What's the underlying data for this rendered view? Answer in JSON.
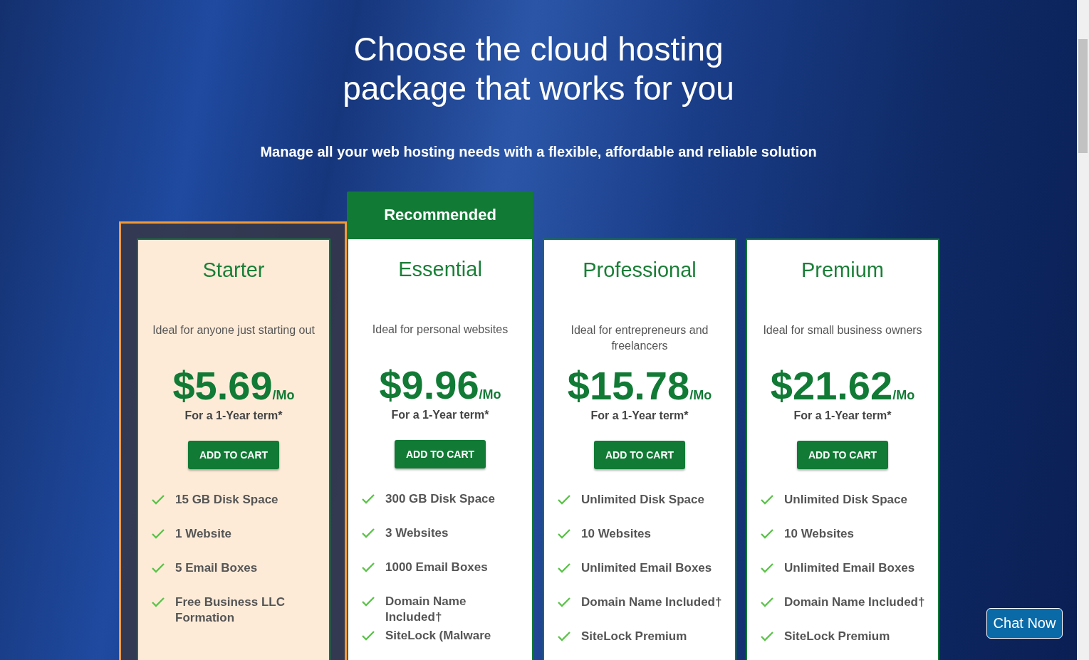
{
  "heading": {
    "title_lines": [
      "Choose the cloud hosting",
      "package that works for you"
    ],
    "subtitle": "Manage all your web hosting needs with a flexible, affordable and reliable solution"
  },
  "plans": [
    {
      "name": "Starter",
      "highlighted": true,
      "description": "Ideal for anyone just starting out",
      "price": "$5.69",
      "per": "/Mo",
      "term": "For a 1-Year term*",
      "button": "ADD TO CART",
      "features": [
        "15 GB Disk Space",
        "1 Website",
        "5 Email Boxes",
        "Free Business LLC Formation"
      ]
    },
    {
      "name": "Essential",
      "highlighted": false,
      "badge": "Recommended",
      "description": "Ideal for personal websites",
      "price": "$9.96",
      "per": "/Mo",
      "term": "For a 1-Year term*",
      "button": "ADD TO CART",
      "features": [
        "300 GB Disk Space",
        "3 Websites",
        "1000 Email Boxes",
        "Domain Name Included†",
        "SiteLock (Malware"
      ]
    },
    {
      "name": "Professional",
      "highlighted": false,
      "description": "Ideal for entrepreneurs and freelancers",
      "price": "$15.78",
      "per": "/Mo",
      "term": "For a 1-Year term*",
      "button": "ADD TO CART",
      "features": [
        "Unlimited Disk Space",
        "10 Websites",
        "Unlimited Email Boxes",
        "Domain Name Included†",
        "SiteLock Premium"
      ]
    },
    {
      "name": "Premium",
      "highlighted": false,
      "description": "Ideal for small business owners",
      "price": "$21.62",
      "per": "/Mo",
      "term": "For a 1-Year term*",
      "button": "ADD TO CART",
      "features": [
        "Unlimited Disk Space",
        "10 Websites",
        "Unlimited Email Boxes",
        "Domain Name Included†",
        "SiteLock Premium"
      ]
    }
  ],
  "chat_button": "Chat Now"
}
